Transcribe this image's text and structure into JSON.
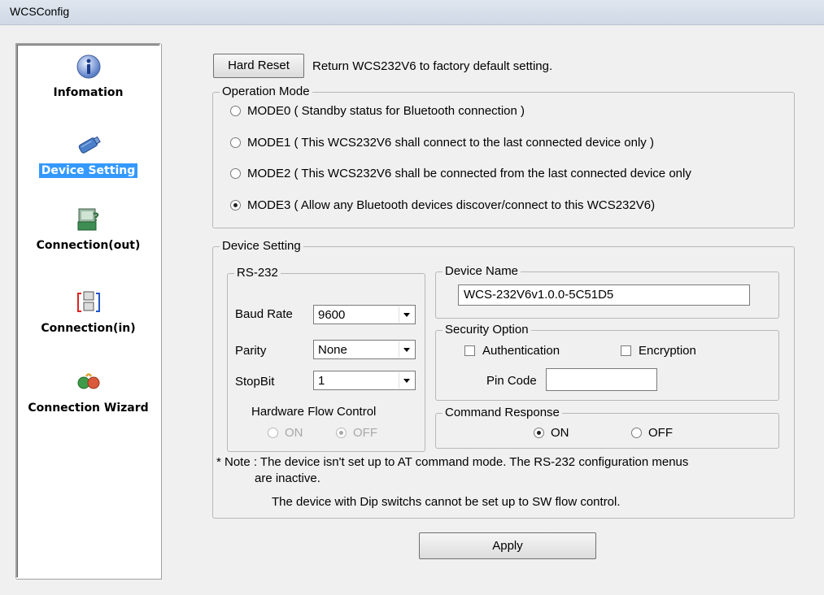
{
  "window": {
    "title": "WCSConfig"
  },
  "sidebar": {
    "items": [
      {
        "label": "Infomation",
        "icon": "info-icon"
      },
      {
        "label": "Device Setting",
        "icon": "serial-adapter-icon",
        "active": true
      },
      {
        "label": "Connection(out)",
        "icon": "connection-out-icon"
      },
      {
        "label": "Connection(in)",
        "icon": "connection-in-icon"
      },
      {
        "label": "Connection Wizard",
        "icon": "wizard-icon"
      }
    ]
  },
  "hard_reset": {
    "button_label": "Hard Reset",
    "description": "Return WCS232V6 to factory default setting."
  },
  "operation_mode": {
    "legend": "Operation Mode",
    "options": [
      {
        "label": "MODE0 ( Standby status for Bluetooth connection )",
        "checked": false
      },
      {
        "label": "MODE1 ( This WCS232V6 shall connect to the last connected device only )",
        "checked": false
      },
      {
        "label": "MODE2 ( This WCS232V6 shall be connected from the last connected device only",
        "checked": false
      },
      {
        "label": "MODE3 ( Allow any Bluetooth devices discover/connect to this WCS232V6)",
        "checked": true
      }
    ]
  },
  "device_setting": {
    "legend": "Device Setting",
    "rs232": {
      "legend": "RS-232",
      "baud_rate": {
        "label": "Baud Rate",
        "value": "9600"
      },
      "parity": {
        "label": "Parity",
        "value": "None"
      },
      "stopbit": {
        "label": "StopBit",
        "value": "1"
      },
      "flow_control": {
        "label": "Hardware Flow Control",
        "on_label": "ON",
        "off_label": "OFF",
        "selected": "OFF",
        "disabled": true
      }
    },
    "device_name": {
      "legend": "Device Name",
      "value": "WCS-232V6v1.0.0-5C51D5"
    },
    "security": {
      "legend": "Security Option",
      "authentication_label": "Authentication",
      "authentication_checked": false,
      "encryption_label": "Encryption",
      "encryption_checked": false,
      "pin_label": "Pin Code",
      "pin_value": ""
    },
    "command_response": {
      "legend": "Command Response",
      "on_label": "ON",
      "off_label": "OFF",
      "selected": "ON"
    },
    "note_line1": "* Note : The device isn't set up to AT command mode. The RS-232 configuration menus",
    "note_line2": "are inactive.",
    "note_line3": "The device with Dip switchs cannot be set up to SW flow control."
  },
  "apply_button": "Apply",
  "colors": {
    "selection": "#3399ff",
    "window_bg": "#f0f0f0"
  }
}
